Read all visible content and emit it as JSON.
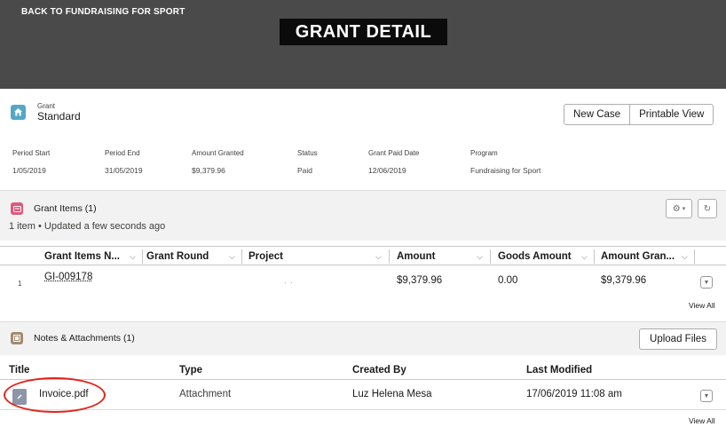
{
  "header": {
    "back_link": "BACK TO FUNDRAISING FOR SPORT",
    "title": "GRANT DETAIL"
  },
  "record": {
    "type_label": "Grant",
    "name": "Standard",
    "icon": "home-icon",
    "buttons": {
      "new_case": "New Case",
      "printable_view": "Printable View"
    }
  },
  "fields": [
    {
      "label": "Period Start",
      "value": "1/05/2019"
    },
    {
      "label": "Period End",
      "value": "31/05/2019"
    },
    {
      "label": "Amount Granted",
      "value": "$9,379.96"
    },
    {
      "label": "Status",
      "value": "Paid"
    },
    {
      "label": "Grant Paid Date",
      "value": "12/06/2019"
    },
    {
      "label": "Program",
      "value": "Fundraising for Sport"
    }
  ],
  "grant_items": {
    "title": "Grant Items (1)",
    "subtitle": "1 item • Updated a few seconds ago",
    "icon": "card-icon",
    "columns": [
      "Grant Items N...",
      "Grant Round",
      "Project",
      "Amount",
      "Goods Amount",
      "Amount Gran..."
    ],
    "rows": [
      {
        "num": "1",
        "name": "GI-009178",
        "grant_round": "",
        "project": "",
        "amount": "$9,379.96",
        "goods_amount": "0.00",
        "amount_granted": "$9,379.96"
      }
    ],
    "view_all": "View All"
  },
  "notes": {
    "title": "Notes & Attachments (1)",
    "upload_button": "Upload Files",
    "icon": "note-icon",
    "columns": [
      "Title",
      "Type",
      "Created By",
      "Last Modified"
    ],
    "rows": [
      {
        "title": "Invoice.pdf",
        "type": "Attachment",
        "created_by": "Luz Helena Mesa",
        "last_modified": "17/06/2019 11:08 am"
      }
    ],
    "view_all": "View All"
  },
  "colors": {
    "banner": "#4a4a4a",
    "title_bg": "#0b0b0b",
    "record_icon": "#54a8c4",
    "grant_items_icon": "#e3587a",
    "notes_icon": "#a28b6f",
    "highlight": "#e2231a"
  }
}
